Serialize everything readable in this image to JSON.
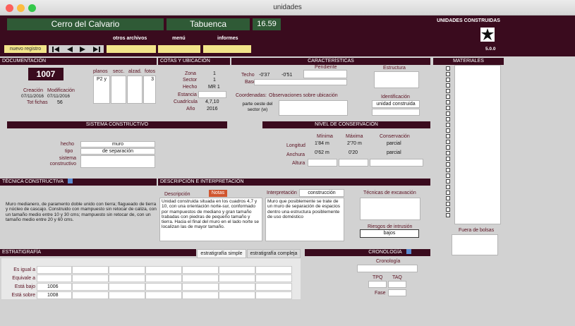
{
  "window": {
    "title": "unidades"
  },
  "top": {
    "site": "Cerro del Calvario",
    "town": "Tabuenca",
    "number": "16.59",
    "panel_title": "UNIDADES CONSTRUIDAS",
    "version": "5.0.0"
  },
  "nav": {
    "otros": "otros archivos",
    "menu": "menú",
    "informes": "informes",
    "nuevo": "nuevo registro"
  },
  "doc": {
    "header": "DOCUMENTACIÓN",
    "id": "1007",
    "planos": "planos",
    "secc": "secc.",
    "alzad": "alzad.",
    "fotos": "fotos",
    "planos_val": "P2 y",
    "fotos_val": "3",
    "creacion": "Creación",
    "modificacion": "Modificación",
    "fecha1": "07/11/2016",
    "fecha2": "07/11/2016",
    "totfichas_label": "Tot fichas",
    "totfichas": "56"
  },
  "cotas": {
    "header": "COTAS Y UBICACIÓN",
    "zona_l": "Zona",
    "zona": "1",
    "sector_l": "Sector",
    "sector": "1",
    "hecho_l": "Hecho",
    "hecho": "MR 1",
    "estancia_l": "Estancia",
    "cuadricula_l": "Cuadrícula",
    "cuadricula": "4,7,10",
    "anio_l": "Año",
    "anio": "2016"
  },
  "caract": {
    "header": "CARACTERÍSTICAS",
    "pendiente": "Pendiente",
    "estructura": "Estructura",
    "techo_l": "Techo",
    "techo1": "-0'37",
    "techo2": "-0'51",
    "base_l": "Base",
    "coord_l": "Coordenadas:",
    "obs_l": "Observaciones sobre ubicación",
    "obs_val": "parte oeste del sector (w)",
    "ident_l": "Identificación",
    "ident_val": "unidad construida"
  },
  "sistema": {
    "header": "SISTEMA CONSTRUCTIVO",
    "hecho_l": "hecho",
    "hecho": "muro",
    "tipo_l": "tipo",
    "tipo": "de separación",
    "sist_l": "sistema constructivo"
  },
  "nivel": {
    "header": "NIVEL DE CONSERVACIÓN",
    "minima": "Mínima",
    "maxima": "Máxima",
    "conservacion": "Conservación",
    "long_l": "Longitud",
    "long_min": "1'84 m",
    "long_max": "2'70 m",
    "long_cons": "parcial",
    "anch_l": "Anchura",
    "anch_min": "0'62 m",
    "anch_max": "0'20",
    "anch_cons": "parcial",
    "altura_l": "Altura"
  },
  "materiales": {
    "header": "MATERIALES",
    "fuera": "Fuera de bolsas"
  },
  "tecnica": {
    "header": "TÉCNICA CONSTRUCTIVA",
    "text": "Muro medianero, de paramento doble unido con tierra; flagueado de tierra y núcleo de cascajo. Construido con mampuesto sin retocar de caliza, con un tamaño medio entre 10 y 30 cms; mampuesto sin retocar de, con un tamaño medio entre 20 y 60 cms."
  },
  "descr": {
    "header": "DESCRIPCIÓN E INTERPRETACIÓN",
    "desc_l": "Descripción",
    "notas": "Notas",
    "desc_text": "Unidad construida situada en los cuadros 4,7 y 10, con una orientación norte-sur, conformado por mampuestos de mediano y gran tamaño trabadas con piedras de pequeño tamaño y tierra. Hacia el final del muro en el lado norte se localizan las de mayor tamaño.",
    "interp_l": "Interpretación",
    "interp_val": "construcción",
    "interp_text": "Muro que posiblemente se trate de un muro de separación de espacios dentro una estructura posiblemente de uso doméstico",
    "tecnicas_l": "Técnicas de excavación",
    "riesgos_l": "Riesgos de intrusión",
    "riesgos_val": "bajos"
  },
  "estrat": {
    "header": "ESTRATIGRAFÍA",
    "tab1": "estratigrafía simple",
    "tab2": "estratigrafía compleja",
    "rows": [
      {
        "label": "Es igual a",
        "val": ""
      },
      {
        "label": "Equivale a",
        "val": ""
      },
      {
        "label": "Está bajo",
        "val": "1006"
      },
      {
        "label": "Está sobre",
        "val": "1008"
      }
    ]
  },
  "crono": {
    "header": "CRONOLOGÍA",
    "cronologia": "Cronología",
    "tpq": "TPQ",
    "taq": "TAQ",
    "fase": "Fase"
  }
}
